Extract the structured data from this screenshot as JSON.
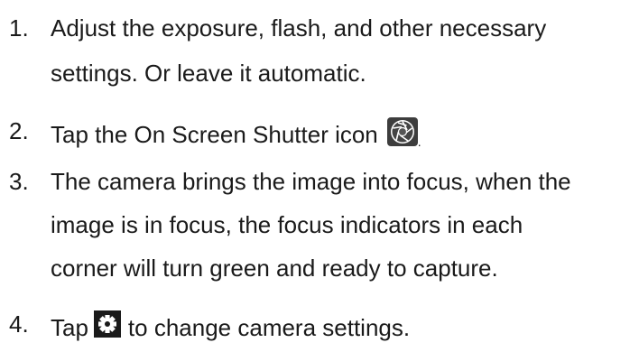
{
  "steps": [
    {
      "number": "1.",
      "lines": [
        "Adjust the exposure, flash, and other necessary",
        "settings. Or leave it automatic."
      ]
    },
    {
      "number": "2.",
      "text_before_icon": "Tap the On Screen Shutter icon",
      "icon": "shutter-icon",
      "text_after_icon": "."
    },
    {
      "number": "3.",
      "lines": [
        "The camera brings the image into focus, when the",
        "image is in focus, the focus indicators in each",
        "corner will turn green and ready to capture."
      ]
    },
    {
      "number": "4.",
      "text_before_icon": "Tap",
      "icon": "gear-icon",
      "text_after_icon": "to change camera settings."
    }
  ]
}
